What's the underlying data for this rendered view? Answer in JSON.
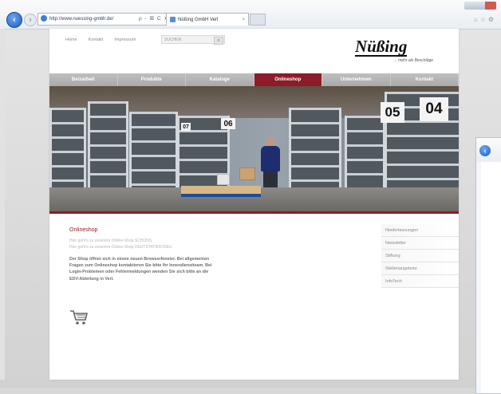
{
  "browser": {
    "address_url": "http://www.nuessing-gmbh.de/",
    "address_controls": "ρ - ☒ C ✕",
    "tab_title": "Nüßing GmbH Verl",
    "tab_close": "×"
  },
  "page": {
    "topnav": [
      "Home",
      "Kontakt",
      "Impressum"
    ],
    "search": {
      "placeholder": "SUCHEN",
      "button": "⌕"
    },
    "logo": {
      "word": "Nüßing",
      "tagline": "... mehr als Beschläge"
    },
    "mainnav": [
      {
        "label": "Beizarbeit",
        "active": false
      },
      {
        "label": "Produkte",
        "active": false
      },
      {
        "label": "Kataloge",
        "active": false
      },
      {
        "label": "Onlineshop",
        "active": true
      },
      {
        "label": "Unternehmen",
        "active": false
      },
      {
        "label": "Kontakt",
        "active": false
      }
    ],
    "hero": {
      "numbers": [
        "05",
        "04",
        "06",
        "07"
      ]
    },
    "content": {
      "title": "Onlineshop",
      "sub_lines": [
        "Hier geht's zu unserem Online-Shop SCHONS",
        "Hier geht's zu unserem Online-Shop DEUTSTATIKKONIG"
      ],
      "paragraph": [
        "Der Shop öffnet sich in einem neuen Browserfenster. Bei allgemeinen",
        "Fragen zum Onlineshop kontaktieren Sie bitte Ihr Innendienstteam. Bei",
        "Login-Problemen oder Fehlermeldungen wenden Sie sich bitte an die",
        "EDV-Abteilung in Verl."
      ]
    },
    "sidebar": [
      "Niederlassungen",
      "Newsletter",
      "Stiftung",
      "Stellenangebote",
      "InfoTech"
    ]
  },
  "colors": {
    "accent": "#8e1b28",
    "nav_grey": "#b3b3b3"
  }
}
